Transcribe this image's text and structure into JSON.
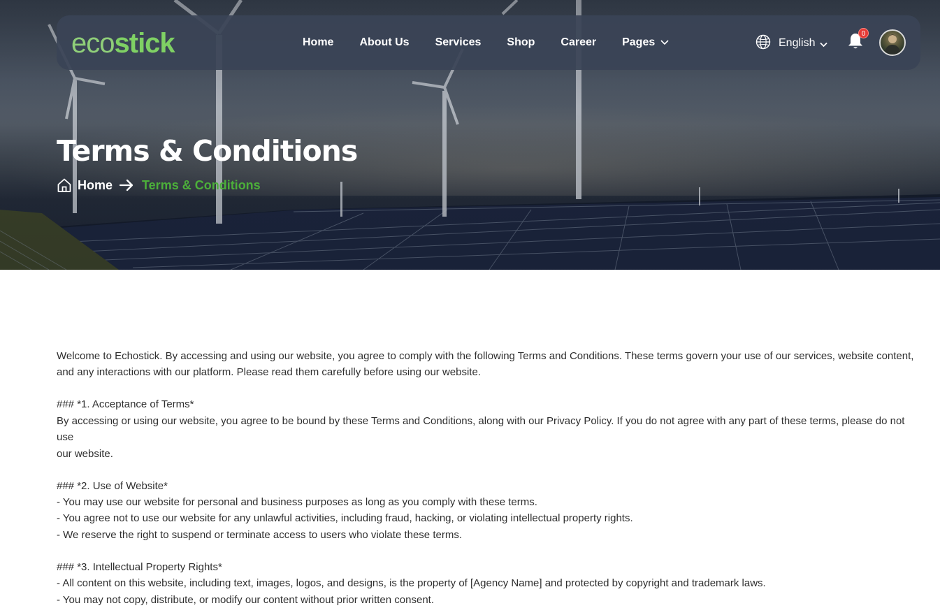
{
  "brand": {
    "logo_part1": "eco",
    "logo_part2": "stick"
  },
  "nav": {
    "items": [
      {
        "label": "Home"
      },
      {
        "label": "About Us"
      },
      {
        "label": "Services"
      },
      {
        "label": "Shop"
      },
      {
        "label": "Career"
      },
      {
        "label": "Pages"
      }
    ],
    "language": "English",
    "notification_count": "0"
  },
  "hero": {
    "title": "Terms & Conditions",
    "breadcrumb": {
      "home": "Home",
      "current": "Terms & Conditions"
    }
  },
  "content": {
    "intro_line1": "Welcome to Echostick. By accessing and using our website, you agree to comply with the following Terms and Conditions. These terms govern your use of our services, website content,",
    "intro_line2": "and any interactions with our platform. Please read them carefully before using our website.",
    "s1_heading": "### *1. Acceptance of Terms*",
    "s1_line1": "By accessing or using our website, you agree to be bound by these Terms and Conditions, along with our Privacy Policy. If you do not agree with any part of these terms, please do not use",
    "s1_line2": "our website.",
    "s2_heading": "### *2. Use of Website*",
    "s2_bullet1": "- You may use our website for personal and business purposes as long as you comply with these terms.",
    "s2_bullet2": "- You agree not to use our website for any unlawful activities, including fraud, hacking, or violating intellectual property rights.",
    "s2_bullet3": "- We reserve the right to suspend or terminate access to users who violate these terms.",
    "s3_heading": "### *3. Intellectual Property Rights*",
    "s3_bullet1": "- All content on this website, including text, images, logos, and designs, is the property of [Agency Name] and protected by copyright and trademark laws.",
    "s3_bullet2": "- You may not copy, distribute, or modify our content without prior written consent."
  },
  "colors": {
    "accent_green": "#4caf3a",
    "logo_green": "#7fd164",
    "navbar_bg": "#3a4456",
    "badge_red": "#e53935"
  },
  "icons": [
    "globe-icon",
    "chevron-down-icon",
    "bell-icon",
    "home-icon",
    "arrow-right-icon"
  ]
}
